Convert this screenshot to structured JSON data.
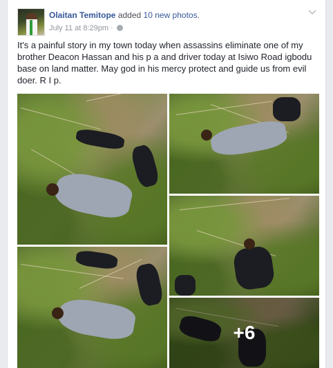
{
  "post": {
    "author": "Olaitan Temitope",
    "action": "added",
    "photo_count_text": "10 new photos",
    "period": ".",
    "timestamp": "July 11 at 8:29pm",
    "separator": " · ",
    "text": "It's a painful story in my town today when assassins eliminate one of my brother Deacon Hassan and his p a and driver today at Isiwo Road igbodu base on land matter. May god in his mercy protect and guide us from evil doer. R I p.",
    "more_photos_label": "+6"
  },
  "icons": {
    "privacy": "globe-icon",
    "options": "chevron-down-icon"
  },
  "colors": {
    "link": "#365899",
    "meta": "#90949c",
    "text": "#1d2129",
    "background": "#e9ebee"
  }
}
